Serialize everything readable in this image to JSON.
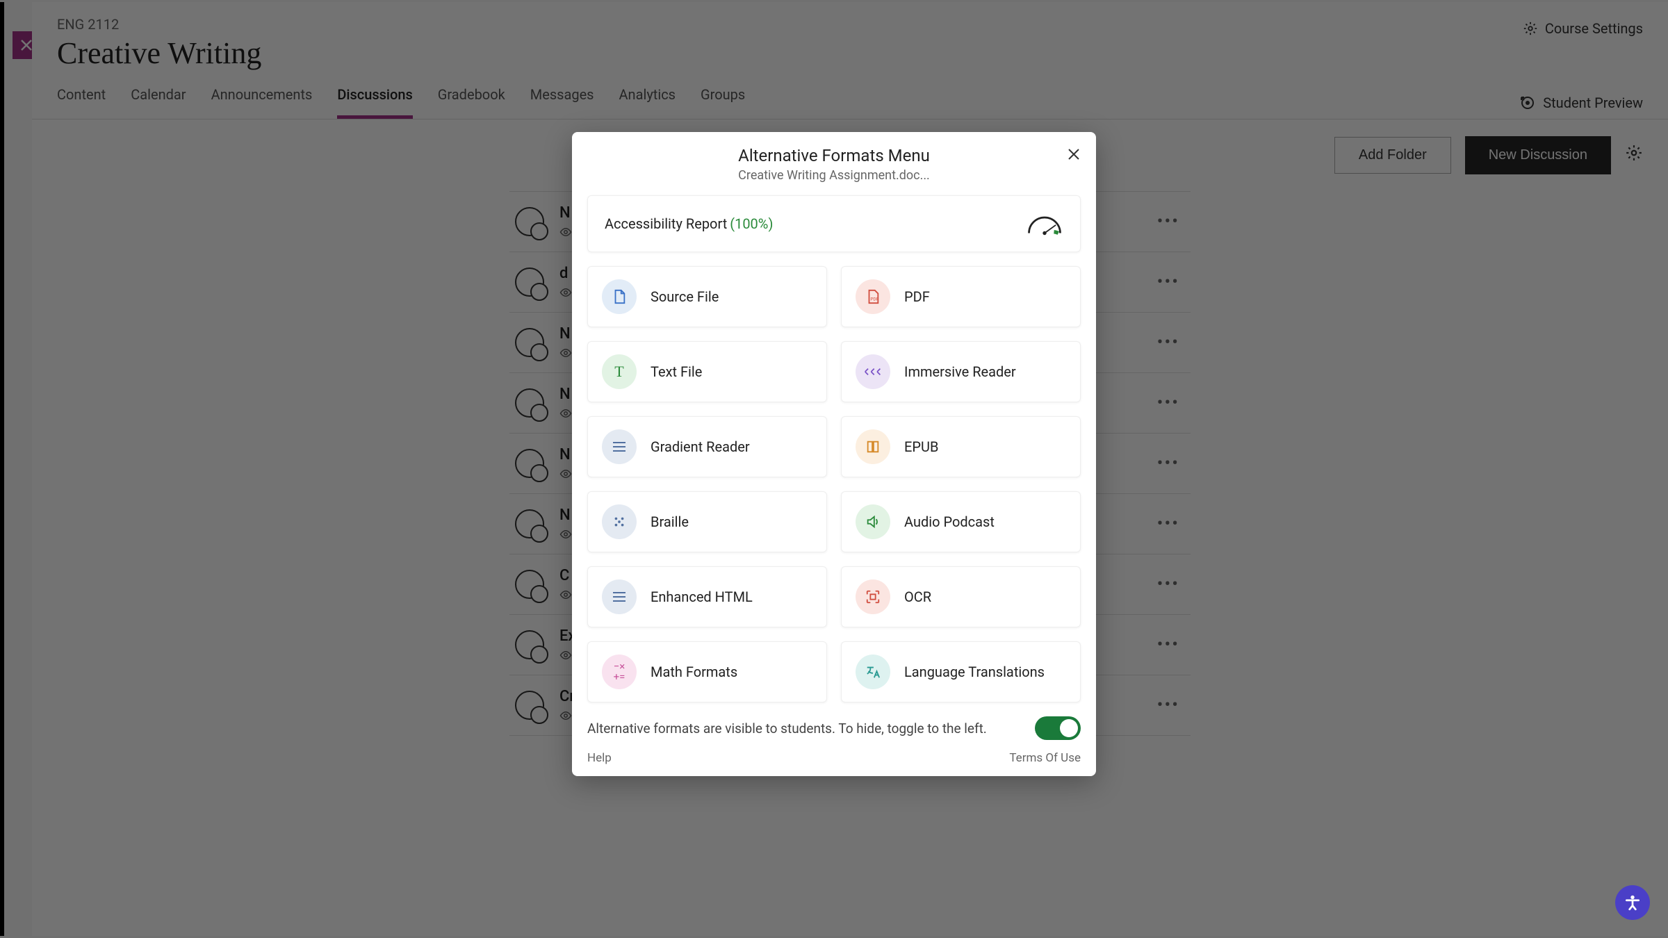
{
  "header": {
    "course_code": "ENG 2112",
    "course_title": "Creative Writing",
    "settings_label": "Course Settings"
  },
  "tabs": {
    "items": [
      "Content",
      "Calendar",
      "Announcements",
      "Discussions",
      "Gradebook",
      "Messages",
      "Analytics",
      "Groups"
    ],
    "active_index": 3,
    "student_preview": "Student Preview"
  },
  "toolbar": {
    "add_folder": "Add Folder",
    "new_discussion": "New Discussion"
  },
  "list": {
    "visible_label": "Visible to students",
    "items": [
      {
        "title": "N"
      },
      {
        "title": "d"
      },
      {
        "title": "N"
      },
      {
        "title": "N"
      },
      {
        "title": "N"
      },
      {
        "title": "N"
      },
      {
        "title": "C"
      },
      {
        "title": "Exam Review"
      },
      {
        "title": "Creative Writing Seminar"
      }
    ]
  },
  "modal": {
    "title": "Alternative Formats Menu",
    "subtitle": "Creative Writing Assignment.doc...",
    "report_label": "Accessibility Report",
    "report_pct": "(100%)",
    "formats": [
      {
        "label": "Source File",
        "icon": "file",
        "bg": "bg-blue"
      },
      {
        "label": "PDF",
        "icon": "pdf",
        "bg": "bg-red"
      },
      {
        "label": "Text File",
        "icon": "T",
        "bg": "bg-green"
      },
      {
        "label": "Immersive Reader",
        "icon": "arrows",
        "bg": "bg-purple"
      },
      {
        "label": "Gradient Reader",
        "icon": "lines",
        "bg": "bg-bluegray"
      },
      {
        "label": "EPUB",
        "icon": "book",
        "bg": "bg-orange"
      },
      {
        "label": "Braille",
        "icon": "dots",
        "bg": "bg-bluegray"
      },
      {
        "label": "Audio Podcast",
        "icon": "speaker",
        "bg": "bg-green"
      },
      {
        "label": "Enhanced HTML",
        "icon": "lines",
        "bg": "bg-bluegray"
      },
      {
        "label": "OCR",
        "icon": "scan",
        "bg": "bg-red"
      },
      {
        "label": "Math Formats",
        "icon": "math",
        "bg": "bg-pink"
      },
      {
        "label": "Language Translations",
        "icon": "translate",
        "bg": "bg-teal"
      }
    ],
    "toggle_text": "Alternative formats are visible to students. To hide, toggle to the left.",
    "toggle_on": true,
    "help": "Help",
    "terms": "Terms Of Use"
  }
}
